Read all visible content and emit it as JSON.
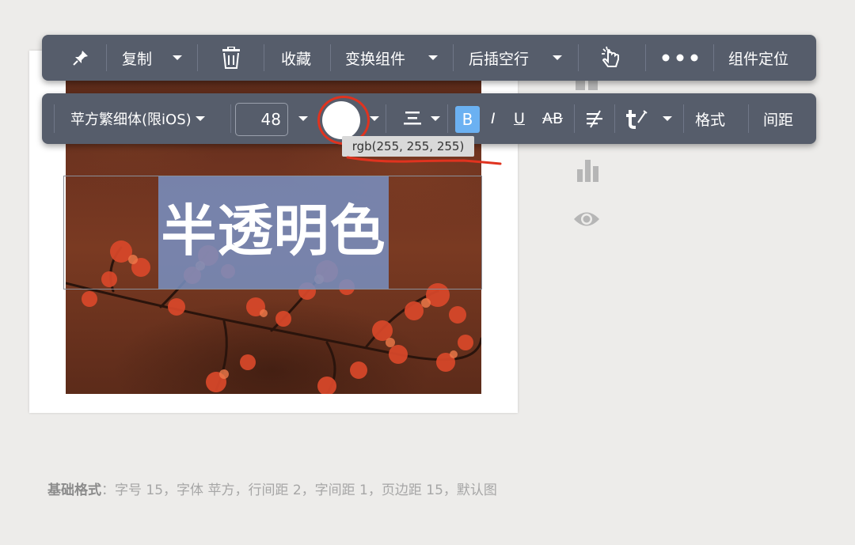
{
  "toolbar_top": {
    "pin_icon": "pin-icon",
    "copy_label": "复制",
    "delete_icon": "trash-icon",
    "favorite_label": "收藏",
    "transform_label": "变换组件",
    "insert_after_label": "后插空行",
    "pointer_icon": "pointer-icon",
    "more_icon": "more-icon",
    "locate_label": "组件定位"
  },
  "toolbar_format": {
    "font_label": "苹方繁细体(限iOS)",
    "font_size": "48",
    "color_swatch": "#ffffff",
    "color_tooltip": "rgb(255, 255, 255)",
    "align_icon": "align-center-icon",
    "bold_label": "B",
    "italic_label": "I",
    "underline_label": "U",
    "strike_label": "AB",
    "clear_format_icon": "clear-format-icon",
    "text_style_icon": "text-style-icon",
    "format_label": "格式",
    "spacing_label": "间距"
  },
  "canvas": {
    "headline": "半透明色",
    "highlight_color": "#7891c3"
  },
  "footer": {
    "label": "基础格式",
    "colon": "：",
    "text": "字号 15，字体 苹方，行间距 2，字间距 1，页边距 15，默认图"
  },
  "colors": {
    "toolbar_bg": "#565d6b",
    "active_blue": "#6bb1f2",
    "annotation_red": "#e0331f"
  }
}
